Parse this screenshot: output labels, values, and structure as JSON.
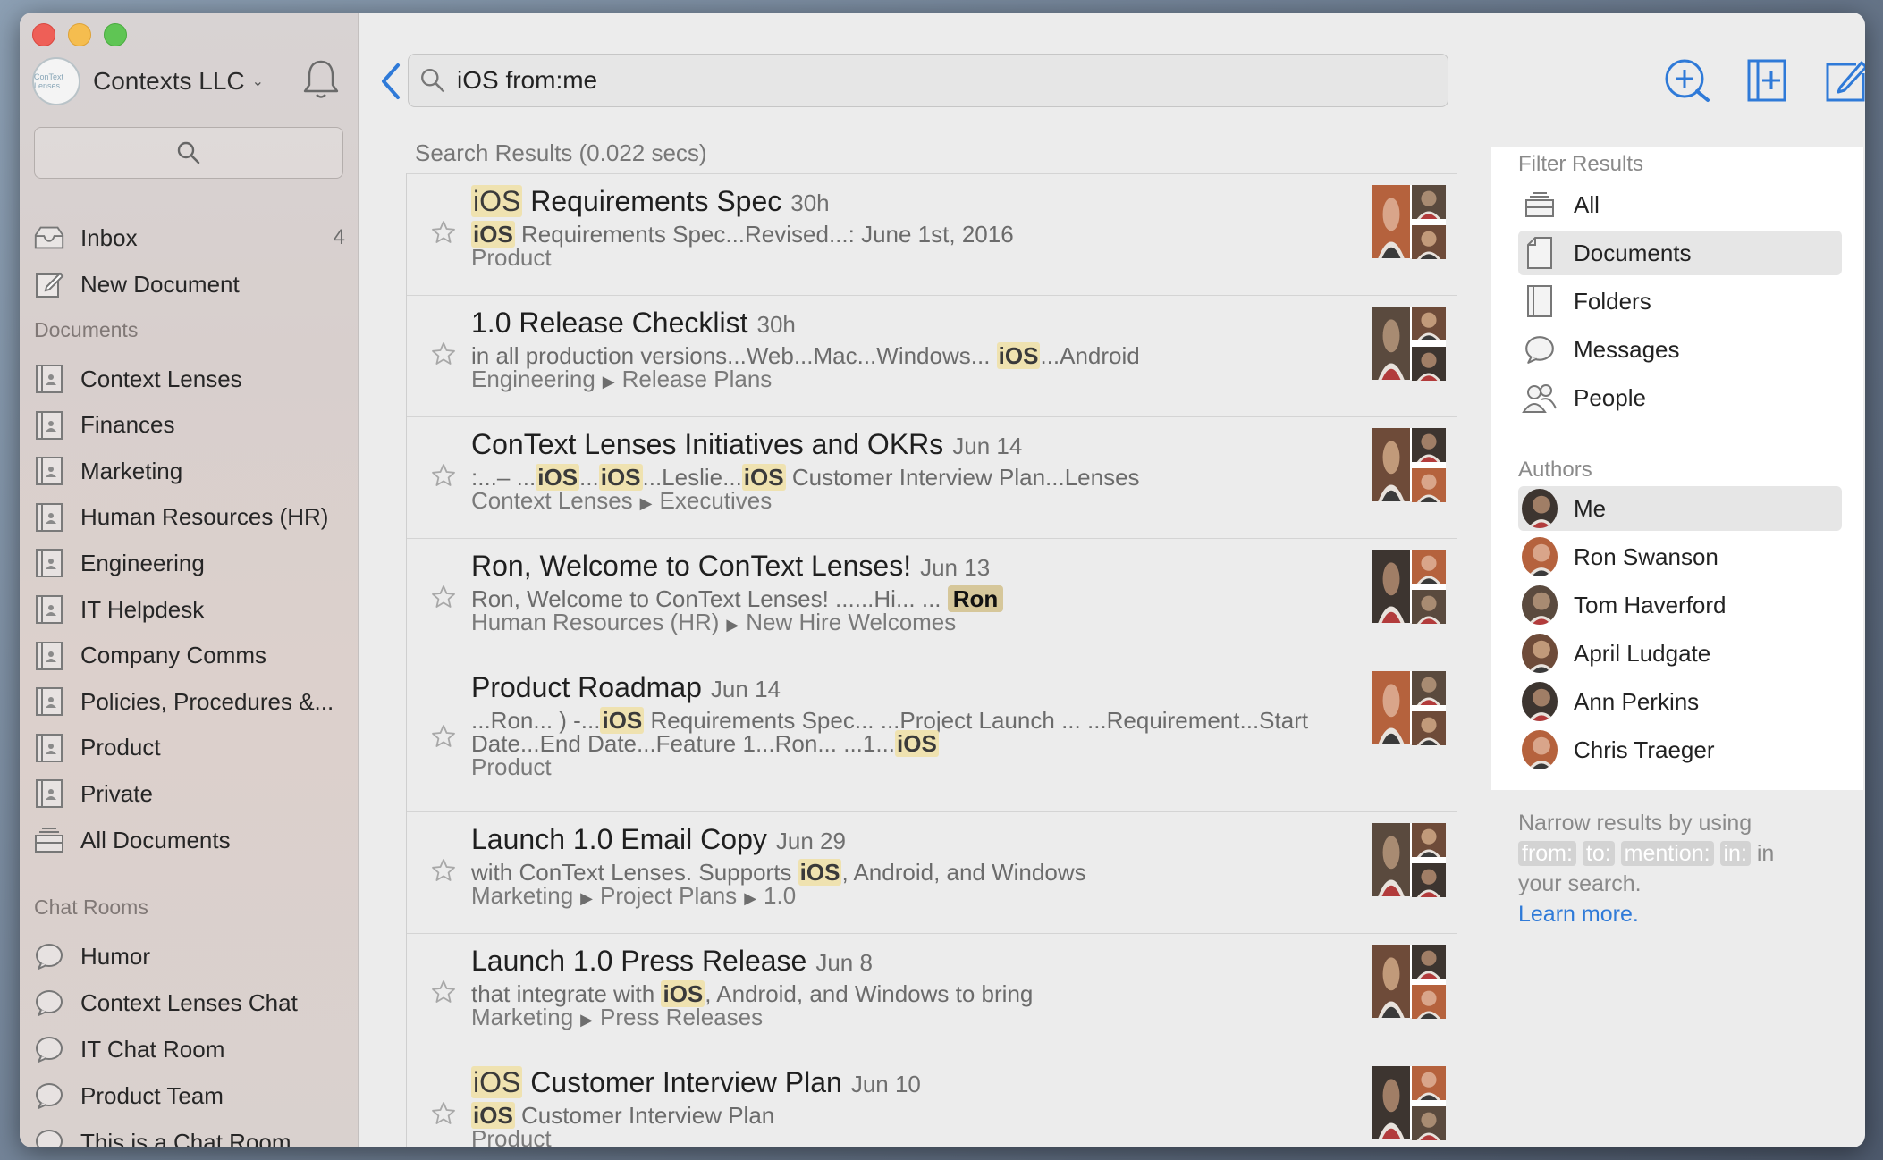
{
  "org": {
    "name": "Contexts LLC",
    "logo_text": "ConText Lenses"
  },
  "sidebar": {
    "inbox": {
      "label": "Inbox",
      "count": "4"
    },
    "new_document": "New Document",
    "documents_header": "Documents",
    "documents": [
      "Context Lenses",
      "Finances",
      "Marketing",
      "Human Resources (HR)",
      "Engineering",
      "IT Helpdesk",
      "Company Comms",
      "Policies, Procedures &...",
      "Product",
      "Private",
      "All Documents"
    ],
    "chat_header": "Chat Rooms",
    "chat_rooms": [
      "Humor",
      "Context Lenses Chat",
      "IT Chat Room",
      "Product Team",
      "This is a Chat Room"
    ]
  },
  "search": {
    "query": "iOS from:me"
  },
  "results_title": "Search Results (0.022 secs)",
  "results": [
    {
      "title_hl": "iOS",
      "title": " Requirements Spec",
      "date": "30h",
      "snip": [
        {
          "h": "iOS"
        },
        {
          "t": " Requirements Spec...Revised...: June 1st, 2016"
        }
      ],
      "path": [
        "Product"
      ]
    },
    {
      "title_hl": "",
      "title": "1.0 Release Checklist",
      "date": "30h",
      "snip": [
        {
          "t": "in all production versions...Web...Mac...Windows... "
        },
        {
          "h": "iOS"
        },
        {
          "t": "...Android"
        }
      ],
      "path": [
        "Engineering",
        "Release Plans"
      ]
    },
    {
      "title_hl": "",
      "title": "ConText Lenses Initiatives and OKRs",
      "date": "Jun 14",
      "snip": [
        {
          "t": ":...– ..."
        },
        {
          "h": "iOS"
        },
        {
          "t": "..."
        },
        {
          "h": "iOS"
        },
        {
          "t": "...Leslie..."
        },
        {
          "h": "iOS"
        },
        {
          "t": " Customer Interview Plan...Lenses"
        }
      ],
      "path": [
        "Context Lenses",
        "Executives"
      ]
    },
    {
      "title_hl": "",
      "title": "Ron, Welcome to ConText Lenses!",
      "date": "Jun 13",
      "snip": [
        {
          "t": "Ron, Welcome to ConText Lenses! ......Hi... ... "
        },
        {
          "d": "Ron"
        }
      ],
      "path": [
        "Human Resources (HR)",
        "New Hire Welcomes"
      ]
    },
    {
      "title_hl": "",
      "title": "Product Roadmap",
      "date": "Jun 14",
      "snip": [
        {
          "t": "...Ron... ) -..."
        },
        {
          "h": "iOS"
        },
        {
          "t": " Requirements Spec... ...Project Launch ... ...Requirement...Start"
        }
      ],
      "snip2": [
        {
          "t": "Date...End Date...Feature 1...Ron... ...1..."
        },
        {
          "h": "iOS"
        }
      ],
      "path": [
        "Product"
      ]
    },
    {
      "title_hl": "",
      "title": "Launch 1.0 Email Copy",
      "date": "Jun 29",
      "snip": [
        {
          "t": "with ConText Lenses. Supports "
        },
        {
          "h": "iOS"
        },
        {
          "t": ", Android, and Windows"
        }
      ],
      "path": [
        "Marketing",
        "Project Plans",
        "1.0"
      ]
    },
    {
      "title_hl": "",
      "title": "Launch 1.0 Press Release",
      "date": "Jun 8",
      "snip": [
        {
          "t": "that integrate with "
        },
        {
          "h": "iOS"
        },
        {
          "t": ", Android, and Windows to bring"
        }
      ],
      "path": [
        "Marketing",
        "Press Releases"
      ]
    },
    {
      "title_hl": "iOS",
      "title": " Customer Interview Plan",
      "date": "Jun 10",
      "snip": [
        {
          "h": "iOS"
        },
        {
          "t": " Customer Interview Plan"
        }
      ],
      "path": [
        "Product"
      ]
    }
  ],
  "filter": {
    "header": "Filter Results",
    "types": [
      "All",
      "Documents",
      "Folders",
      "Messages",
      "People"
    ],
    "authors_header": "Authors",
    "authors": [
      "Me",
      "Ron Swanson",
      "Tom Haverford",
      "April Ludgate",
      "Ann Perkins",
      "Chris Traeger"
    ]
  },
  "hint": {
    "line1": "Narrow results by using",
    "keywords": [
      "from:",
      "to:",
      "mention:",
      "in:"
    ],
    "after_keywords": "in",
    "line3": "your search.",
    "learn_more": "Learn more."
  },
  "colors": {
    "accent": "#2f7ad8",
    "highlight": "#efe2b0",
    "close": "#ee5f57",
    "minimize": "#f5bd4f",
    "maximize": "#5fc554"
  }
}
